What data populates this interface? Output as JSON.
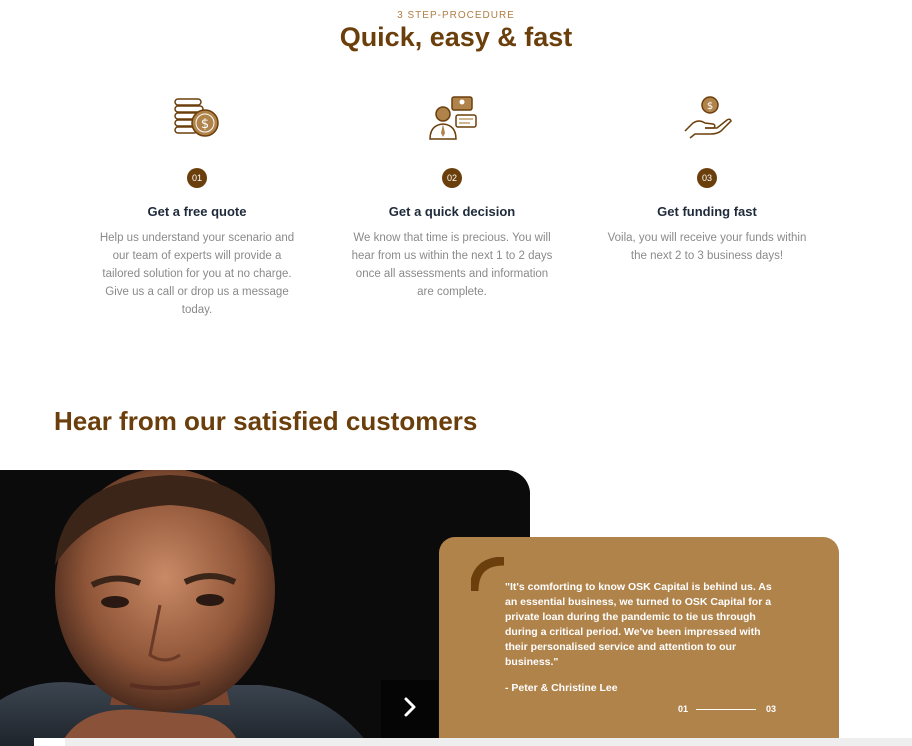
{
  "header": {
    "eyebrow": "3 STEP-PROCEDURE",
    "title": "Quick, easy & fast"
  },
  "steps": [
    {
      "icon": "coins-dollar-icon",
      "number": "01",
      "title": "Get a free quote",
      "description": "Help us understand your scenario and our team of experts will provide a tailored solution for you at no charge. Give us a call or drop us a message today."
    },
    {
      "icon": "consultant-chat-icon",
      "number": "02",
      "title": "Get a quick decision",
      "description": "We know that time is precious. You will hear from us within the next 1 to 2 days once all assessments and information are complete."
    },
    {
      "icon": "hand-coin-icon",
      "number": "03",
      "title": "Get funding fast",
      "description": "Voila, you will receive your funds within the next 2 to 3 business days!"
    }
  ],
  "testimonials": {
    "title": "Hear from our satisfied customers",
    "quote": "\"It's comforting to know OSK Capital is behind us. As an essential business, we turned to OSK Capital for a private loan during the pandemic to tie us through during a critical period. We've been impressed with their personalised service and attention to our business.\"",
    "author": "- Peter & Christine Lee",
    "pager": {
      "current": "01",
      "total": "03"
    },
    "next_icon": "chevron-right-icon"
  },
  "colors": {
    "brand_brown": "#6b3f0c",
    "card_tan": "#b0834b",
    "accent_light": "#b07f45"
  }
}
